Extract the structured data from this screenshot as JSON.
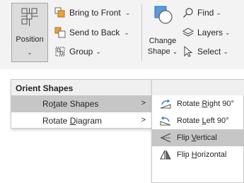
{
  "ribbon": {
    "position": {
      "label": "Position"
    },
    "bring_to_front": {
      "label": "Bring to Front",
      "icon": "bring-to-front-icon"
    },
    "send_to_back": {
      "label": "Send to Back",
      "icon": "send-to-back-icon"
    },
    "group": {
      "label": "Group",
      "icon": "group-icon"
    },
    "change_shape": {
      "line1": "Change",
      "line2": "Shape"
    },
    "find": {
      "label": "Find",
      "icon": "search-icon"
    },
    "layers": {
      "label": "Layers",
      "icon": "layers-icon"
    },
    "select": {
      "label": "Select",
      "icon": "cursor-icon"
    }
  },
  "orient_menu": {
    "header": "Orient Shapes",
    "items": [
      {
        "pre": "Ro",
        "u": "t",
        "post": "ate Shapes",
        "highlighted": true
      },
      {
        "pre": "Rotate ",
        "u": "D",
        "post": "iagram",
        "highlighted": false
      }
    ]
  },
  "rotate_menu": {
    "items": [
      {
        "pre": "Rotate ",
        "u": "R",
        "post": "ight 90°",
        "icon": "rotate-right-icon",
        "highlighted": false
      },
      {
        "pre": "Rotate ",
        "u": "L",
        "post": "eft 90°",
        "icon": "rotate-left-icon",
        "highlighted": false
      },
      {
        "pre": "Flip ",
        "u": "V",
        "post": "ertical",
        "icon": "flip-vertical-icon",
        "highlighted": true
      },
      {
        "pre": "Flip ",
        "u": "H",
        "post": "orizontal",
        "icon": "flip-horizontal-icon",
        "highlighted": false
      }
    ]
  },
  "colors": {
    "highlight": "#c6c6c6",
    "ribbon_bg": "#f3f3f3",
    "accent_blue": "#2b6cc4",
    "accent_orange": "#e8a33a"
  }
}
